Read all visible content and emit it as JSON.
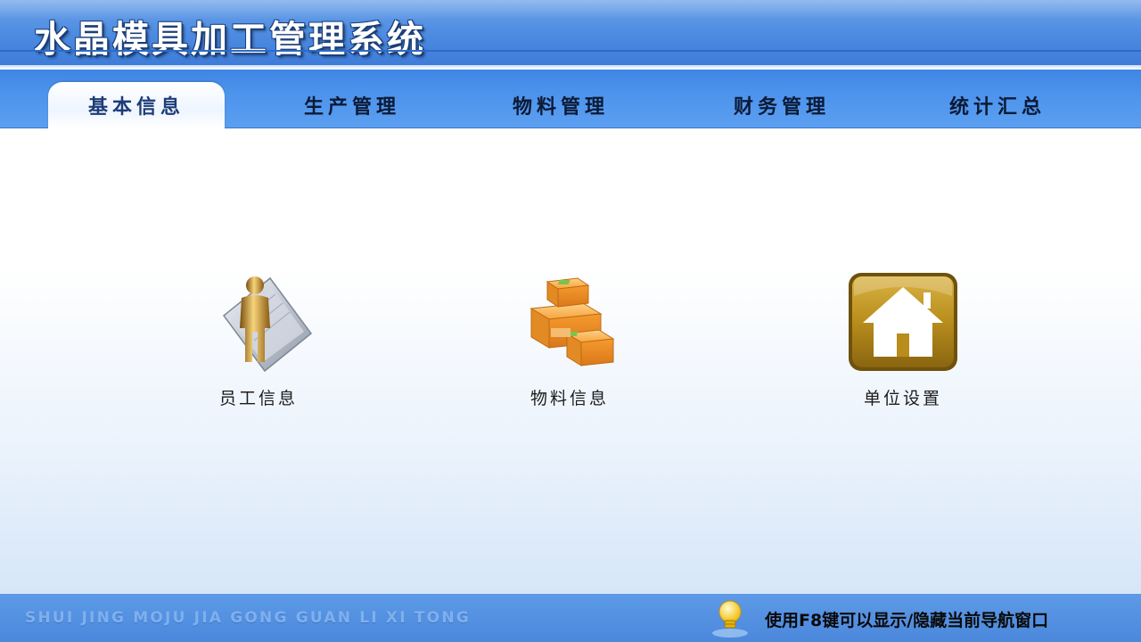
{
  "app": {
    "title": "水晶模具加工管理系统"
  },
  "tabs": [
    {
      "label": "基本信息",
      "active": true
    },
    {
      "label": "生产管理",
      "active": false
    },
    {
      "label": "物料管理",
      "active": false
    },
    {
      "label": "财务管理",
      "active": false
    },
    {
      "label": "统计汇总",
      "active": false
    }
  ],
  "tiles": [
    {
      "label": "员工信息",
      "icon": "employee-person-icon"
    },
    {
      "label": "物料信息",
      "icon": "boxes-icon"
    },
    {
      "label": "单位设置",
      "icon": "house-icon"
    }
  ],
  "footer": {
    "pinyin": "SHUI JING MOJU JIA GONG GUAN LI XI TONG",
    "hint": "使用F8键可以显示/隐藏当前导航窗口",
    "hint_icon": "lightbulb-icon"
  },
  "colors": {
    "banner": "#4f8de2",
    "tabbar": "#4c93ec",
    "footer": "#4b88dc"
  }
}
